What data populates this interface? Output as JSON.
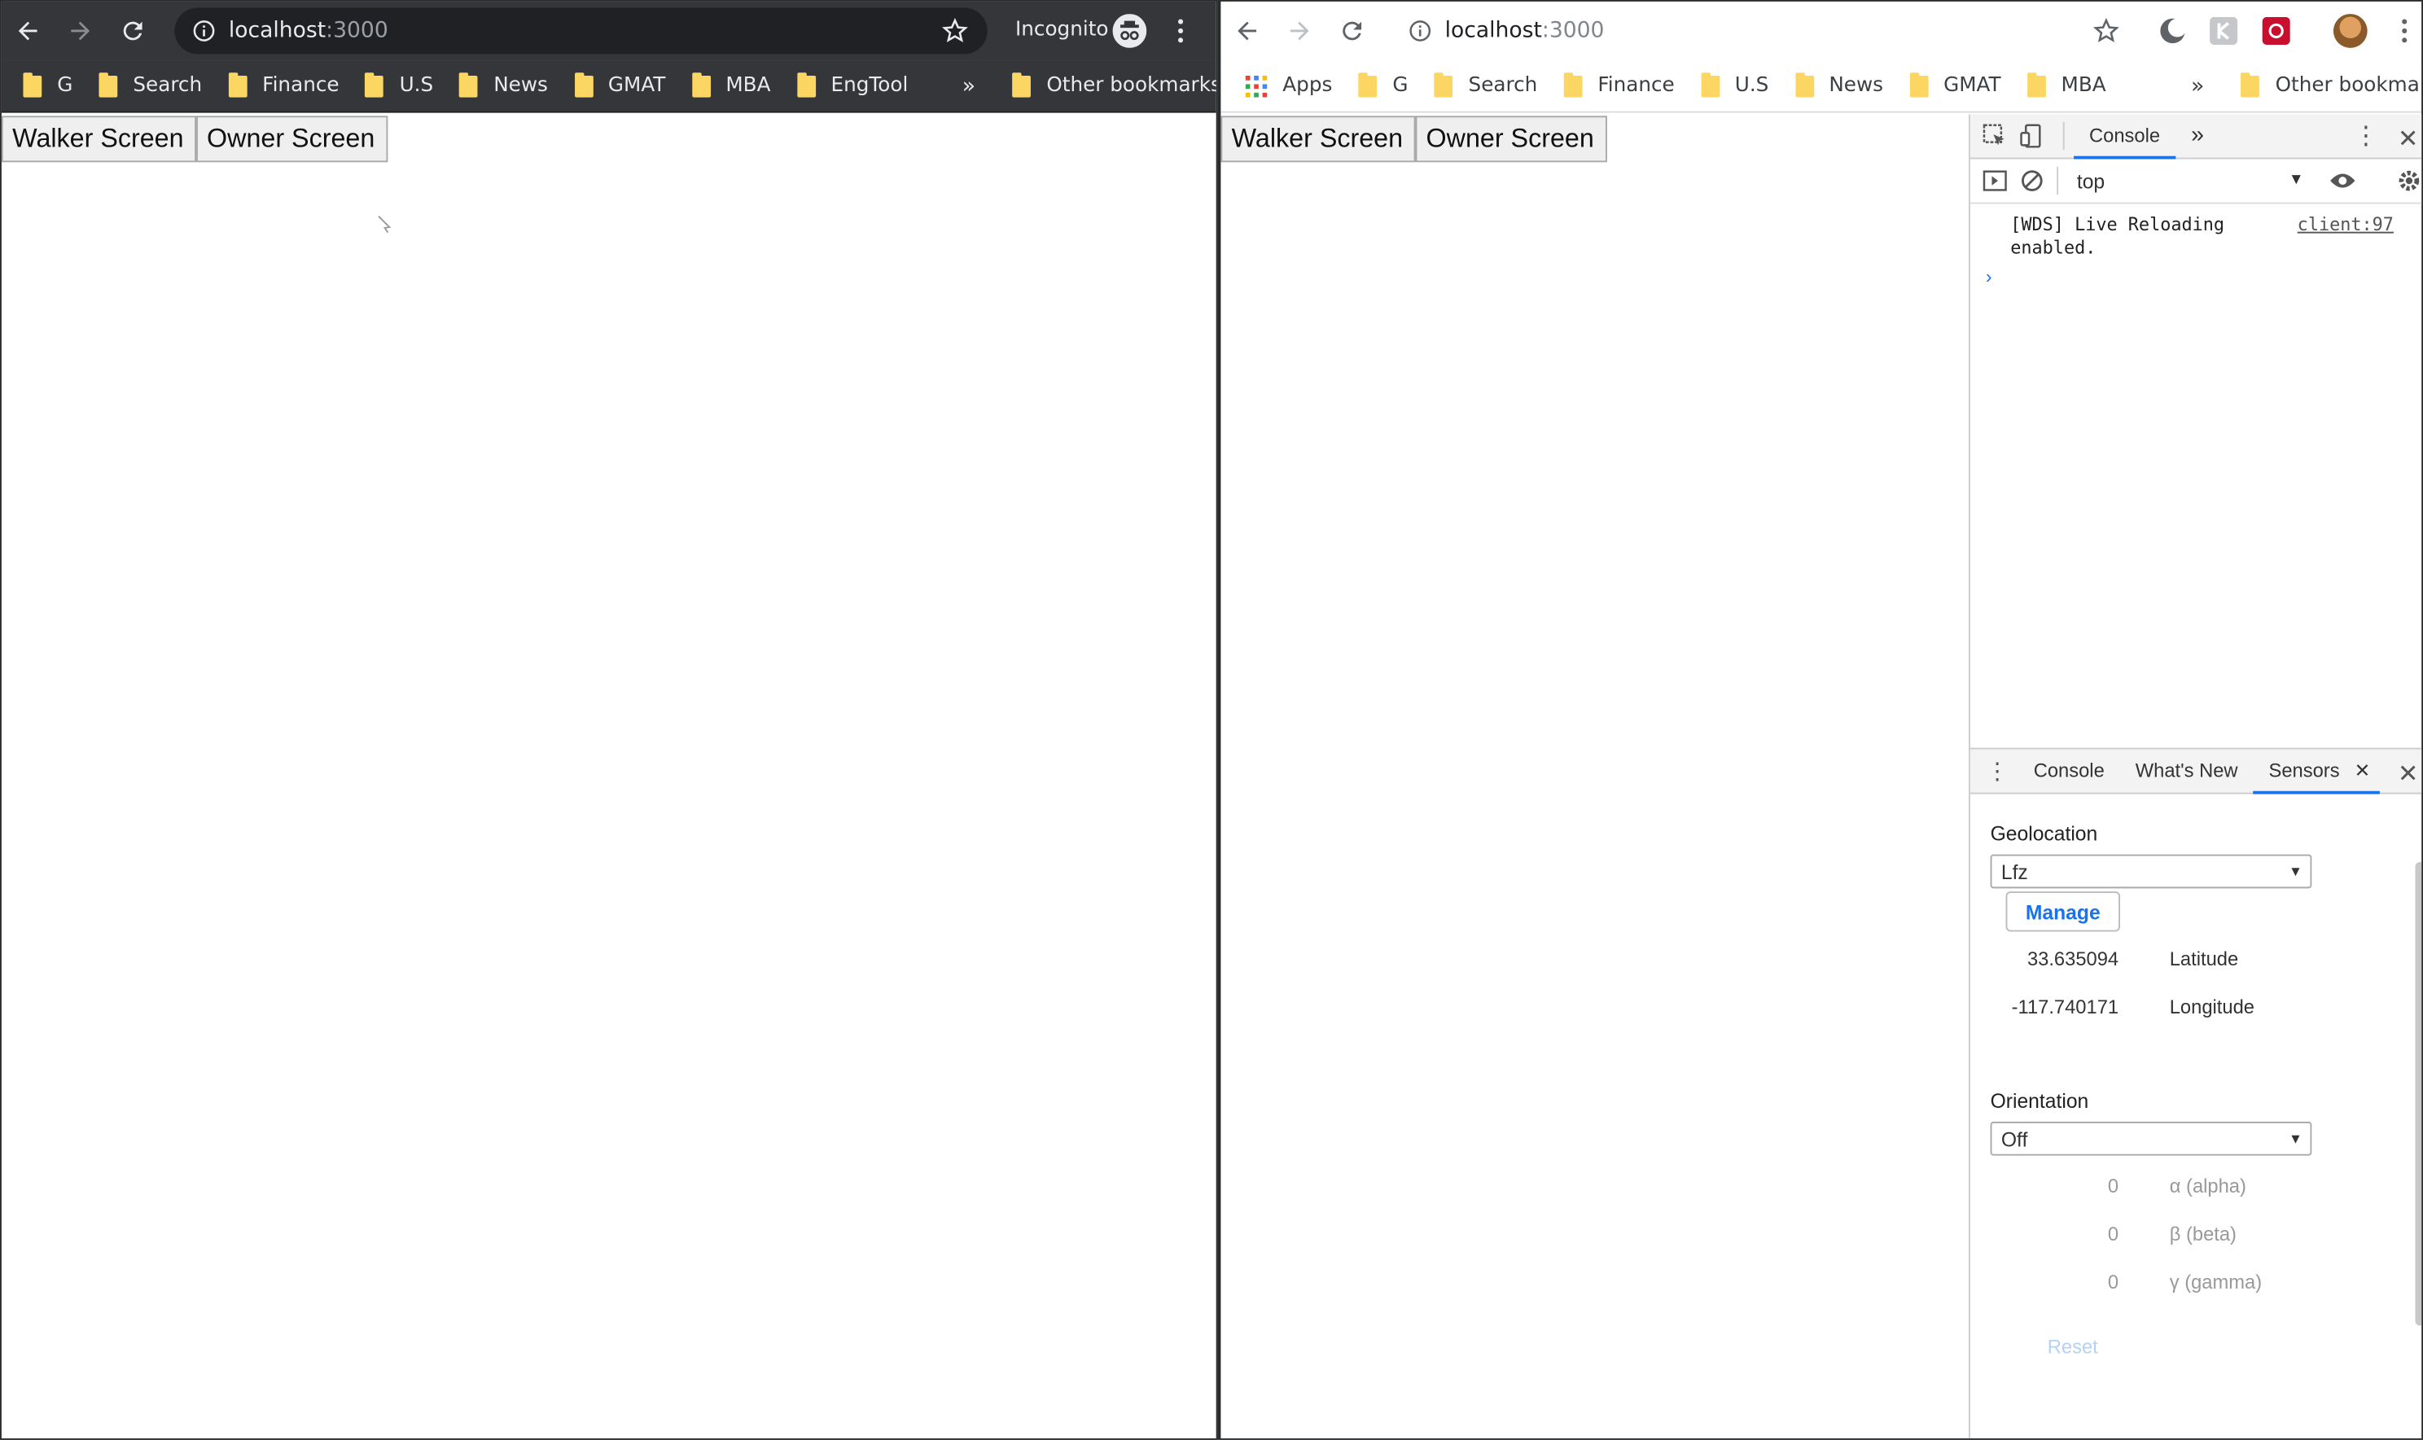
{
  "left_browser": {
    "url_host": "localhost",
    "url_port": ":3000",
    "profile_label": "Incognito",
    "bookmarks": [
      "G",
      "Search",
      "Finance",
      "U.S",
      "News",
      "GMAT",
      "MBA",
      "EngTool"
    ],
    "overflow_label": "»",
    "other_bookmarks": "Other bookmarks",
    "page_buttons": [
      "Walker Screen",
      "Owner Screen"
    ]
  },
  "right_browser": {
    "url_host": "localhost",
    "url_port": ":3000",
    "apps_label": "Apps",
    "bookmarks": [
      "G",
      "Search",
      "Finance",
      "U.S",
      "News",
      "GMAT",
      "MBA"
    ],
    "overflow_label": "»",
    "other_bookmarks": "Other bookmarks",
    "page_buttons": [
      "Walker Screen",
      "Owner Screen"
    ]
  },
  "devtools": {
    "top_tab": "Console",
    "more_tabs": "»",
    "context": "top",
    "log_message": "[WDS] Live Reloading enabled.",
    "log_source": "client:97",
    "prompt": "›",
    "drawer_tabs": [
      "Console",
      "What's New",
      "Sensors"
    ],
    "sensors": {
      "geolocation_label": "Geolocation",
      "geolocation_value": "Lfz",
      "manage_label": "Manage",
      "latitude_value": "33.635094",
      "latitude_label": "Latitude",
      "longitude_value": "-117.740171",
      "longitude_label": "Longitude",
      "orientation_label": "Orientation",
      "orientation_value": "Off",
      "alpha_value": "0",
      "alpha_label": "α (alpha)",
      "beta_value": "0",
      "beta_label": "β (beta)",
      "gamma_value": "0",
      "gamma_label": "γ (gamma)",
      "reset_label": "Reset"
    }
  },
  "colors": {
    "dark_toolbar": "#35363a",
    "folder": "#fcd663",
    "accent": "#1a73e8"
  }
}
